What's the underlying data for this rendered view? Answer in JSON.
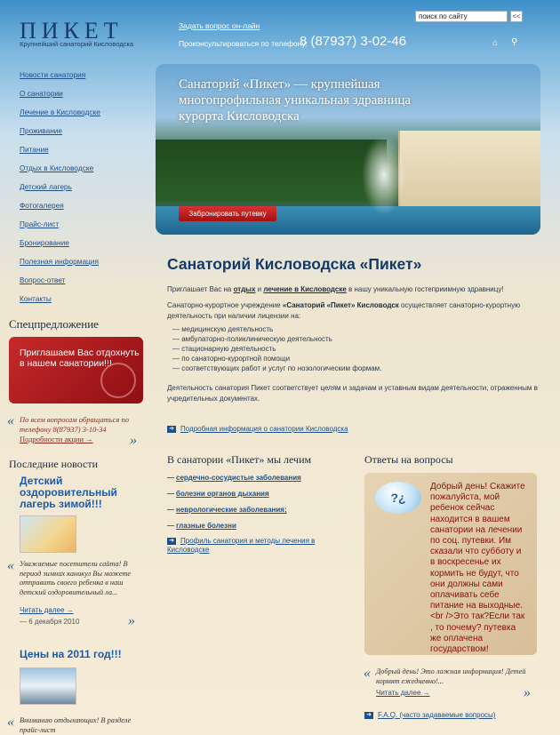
{
  "header": {
    "logo_title": "ПИКЕТ",
    "logo_subtitle": "Крупнейший санаторий Кисловодска",
    "ask_link": "Задать вопрос он-лайн",
    "phone_label": "Проконсультироваться по телефону:",
    "phone_number": "8 (87937) 3-02-46",
    "search_value": "поиск по сайту",
    "search_button": "<<"
  },
  "nav": {
    "items": [
      "Новости санатория",
      "О санатории",
      "Лечение в Кисловодске",
      "Проживание",
      "Питание",
      "Отдых в Кисловодске",
      "Детский лагерь",
      "Фотогалерея",
      "Прайс-лист",
      "Бронирование",
      "Полезная информация",
      "Вопрос-ответ",
      "Контакты"
    ]
  },
  "special": {
    "title": "Спецпредложение",
    "banner_text": "Приглашаем Вас отдохнуть в нашем санатории!!!",
    "note": "По всем вопросам обращаться по телефону 8(87937) 3-10-34",
    "more": "Подробности акции →"
  },
  "news": {
    "title": "Последние новости",
    "items": [
      {
        "headline": "Детский оздоровительный лагерь зимой!!!",
        "text": "Уважаемые посетители сайта! В период зимних каникул Вы можете отправить своего ребенка в наш детский оздоровительный ла...",
        "more": "Читать далее →",
        "date": "— 6 декабря 2010"
      },
      {
        "headline": "Цены на 2011 год!!!",
        "text": "Вниманию отдыхающих! В разделе прайс-лист"
      }
    ]
  },
  "hero": {
    "caption": "Санаторий «Пикет» — крупнейшая многопрофильная уникальная здравница курорта Кисловодска",
    "button": "Забронировать путевку"
  },
  "main": {
    "title": "Санаторий Кисловодска «Пикет»",
    "intro_a": "Приглашает Вас на ",
    "intro_b": "отдых",
    "intro_c": " и ",
    "intro_d": "лечение в Кисловодске",
    "intro_e": " в нашу уникальную гостеприимную здравницу!",
    "desc_a": "Санаторно-курортное учреждение ",
    "desc_b": "«Санаторий «Пикет» Кисловодск",
    "desc_c": " осуществляет санаторно-курортную деятельность при наличии лицензии на:",
    "list": [
      "медицинскую деятельность",
      "амбулаторно-поликлиническую деятельность",
      "стационарную деятельность",
      "по санаторно-курортной помощи",
      "соответствующих работ и услуг по нозологическим формам."
    ],
    "activity": "Деятельность санатория Пикет соответствует целям и задачам и уставным видам деятельности, отраженным в учредительных документах.",
    "detail_link": "Подробная информация о санатории Кисловодска"
  },
  "treatment": {
    "title": "В санатории «Пикет» мы лечим",
    "items": [
      "сердечно-сосудистые заболевания",
      "болезни органов дыхания",
      "неврологические заболевания;",
      "глазные болезни"
    ],
    "profile_link": "Профиль санатория и методы лечения в Кисловодске"
  },
  "faq": {
    "title": "Ответы на вопросы",
    "bubble": "?¿",
    "question": "Добрый день! Скажите пожалуйста, мой ребенок сейчас находится в вашем санатории на лечении по соц. путевки. Им сказали что субботу и в воскресенье их кормить не будут, что они должны сами оплачивать себе питание на выходные. <br />Это так?Если так , то почему? путевка же оплачена государством!",
    "note": "Добрый день! Это ложная информация! Детей кормят ежедневно!...",
    "more": "Читать далее →",
    "link": "F.A.Q. (часто задаваемые вопросы)"
  }
}
